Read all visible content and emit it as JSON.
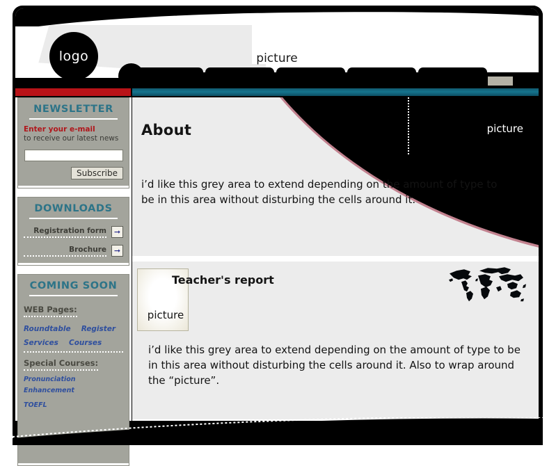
{
  "header": {
    "logo_text": "logo",
    "picture_label": "picture",
    "nav_tabs": [
      {
        "label": ""
      },
      {
        "label": ""
      },
      {
        "label": ""
      },
      {
        "label": ""
      },
      {
        "label": ""
      }
    ]
  },
  "colors": {
    "red_bar": "#b81318",
    "teal_bar": "#15748e",
    "panel_bg": "#a3a49c",
    "panel_title": "#2d7488",
    "link_blue": "#2f4f9e",
    "alert_red": "#b0171c",
    "swoosh_pink": "#c2828f",
    "card_bg": "#ececec"
  },
  "sidebar": {
    "newsletter": {
      "title": "NEWSLETTER",
      "line1": "Enter your e-mail",
      "line2": "to receive our latest news",
      "input_value": "",
      "input_placeholder": "",
      "subscribe_label": "Subscribe"
    },
    "downloads": {
      "title": "DOWNLOADS",
      "items": [
        {
          "label": "Registration form",
          "icon": "arrow-right-icon"
        },
        {
          "label": "Brochure",
          "icon": "arrow-right-icon"
        }
      ]
    },
    "coming_soon": {
      "title": "COMING SOON",
      "web_pages_heading": "WEB Pages:",
      "web_pages_links": [
        "Roundtable",
        "Register",
        "Services",
        "Courses"
      ],
      "special_courses_heading": "Special Courses:",
      "special_courses_links": [
        "Pronunciation Enhancement",
        "TOEFL"
      ]
    }
  },
  "main": {
    "about": {
      "title": "About",
      "picture_label": "picture",
      "body": "i’d like this grey area to extend depending on the amount of type to be in this area without disturbing the cells around it."
    },
    "report": {
      "title": "Teacher's report",
      "picture_label": "picture",
      "body": "i’d like this grey area to extend depending on the amount of type to be in this area without disturbing the cells around it. Also to wrap around the “picture”.",
      "map_icon": "world-map-icon"
    }
  }
}
